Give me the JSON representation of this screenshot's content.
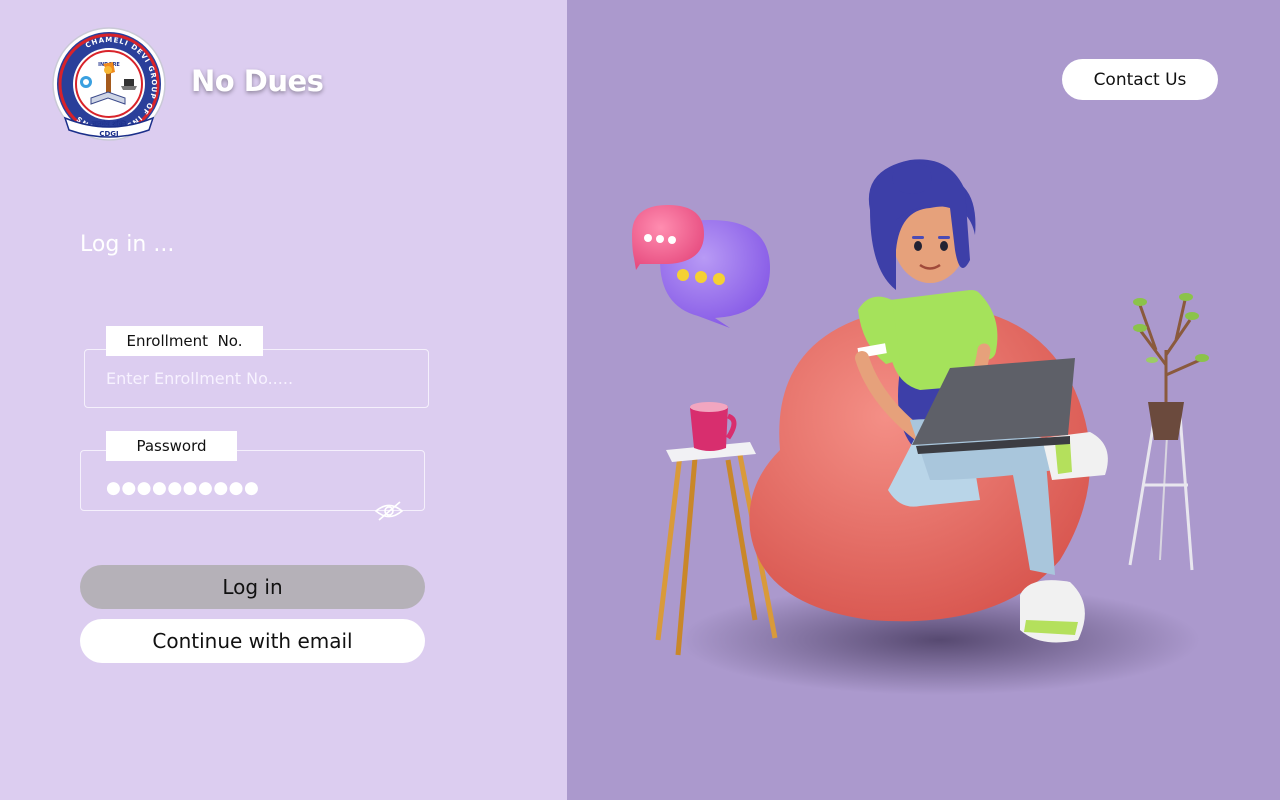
{
  "app": {
    "title": "No Dues"
  },
  "logo": {
    "ring_text": "CHAMELI DEVI GROUP OF INSTITUTIONS",
    "city": "INDORE",
    "motto": "ज्ञानमेव शक्ति",
    "abbrev": "CDGI"
  },
  "login": {
    "heading": "Log in ...",
    "enrollment": {
      "label": "Enrollment  No.",
      "placeholder": "Enter Enrollment No....."
    },
    "password": {
      "label": "Password",
      "masked_value": "●●●●●●●●●●"
    },
    "login_button": "Log in",
    "email_button": "Continue with email"
  },
  "header": {
    "contact_button": "Contact Us"
  },
  "colors": {
    "left_bg": "#dccdf0",
    "right_bg": "#ab99cd",
    "login_button_bg": "#b5b1b8",
    "white": "#ffffff"
  },
  "icons": {
    "password_toggle": "eye-off-icon"
  }
}
